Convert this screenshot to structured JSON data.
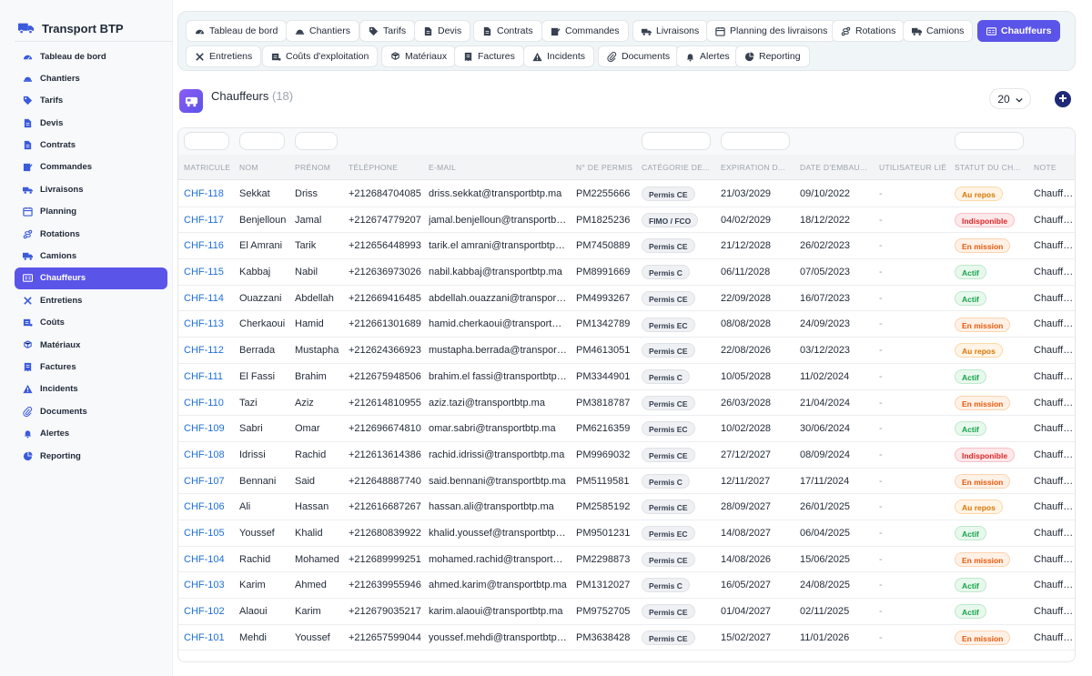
{
  "brand": {
    "name": "Transport BTP"
  },
  "sidebar": {
    "items": [
      {
        "label": "Tableau de bord",
        "icon": "dashboard-icon"
      },
      {
        "label": "Chantiers",
        "icon": "hardhat-icon"
      },
      {
        "label": "Tarifs",
        "icon": "tag-icon"
      },
      {
        "label": "Devis",
        "icon": "file-icon"
      },
      {
        "label": "Contrats",
        "icon": "file-icon"
      },
      {
        "label": "Commandes",
        "icon": "order-icon"
      },
      {
        "label": "Livraisons",
        "icon": "delivery-icon"
      },
      {
        "label": "Planning",
        "icon": "calendar-icon"
      },
      {
        "label": "Rotations",
        "icon": "route-icon"
      },
      {
        "label": "Camions",
        "icon": "truck-icon"
      },
      {
        "label": "Chauffeurs",
        "icon": "id-card-icon",
        "active": true
      },
      {
        "label": "Entretiens",
        "icon": "tools-icon"
      },
      {
        "label": "Coûts",
        "icon": "money-icon"
      },
      {
        "label": "Matériaux",
        "icon": "cubes-icon"
      },
      {
        "label": "Factures",
        "icon": "invoice-icon"
      },
      {
        "label": "Incidents",
        "icon": "warning-icon"
      },
      {
        "label": "Documents",
        "icon": "paperclip-icon"
      },
      {
        "label": "Alertes",
        "icon": "bell-icon"
      },
      {
        "label": "Reporting",
        "icon": "chart-pie-icon"
      }
    ]
  },
  "tabs": [
    {
      "label": "Tableau de bord",
      "icon": "dashboard-icon"
    },
    {
      "label": "Chantiers",
      "icon": "hardhat-icon"
    },
    {
      "label": "Tarifs",
      "icon": "tag-icon"
    },
    {
      "label": "Devis",
      "icon": "file-icon"
    },
    {
      "label": "Contrats",
      "icon": "file-icon"
    },
    {
      "label": "Commandes",
      "icon": "order-icon"
    },
    {
      "label": "Livraisons",
      "icon": "delivery-icon"
    },
    {
      "label": "Planning des livraisons",
      "icon": "calendar-icon"
    },
    {
      "label": "Rotations",
      "icon": "route-icon"
    },
    {
      "label": "Camions",
      "icon": "truck-icon"
    },
    {
      "label": "Chauffeurs",
      "icon": "id-card-icon",
      "active": true
    },
    {
      "label": "Entretiens",
      "icon": "tools-icon"
    },
    {
      "label": "Coûts d'exploitation",
      "icon": "money-icon"
    },
    {
      "label": "Matériaux",
      "icon": "cubes-icon"
    },
    {
      "label": "Factures",
      "icon": "invoice-icon"
    },
    {
      "label": "Incidents",
      "icon": "warning-icon"
    },
    {
      "label": "Documents",
      "icon": "paperclip-icon"
    },
    {
      "label": "Alertes",
      "icon": "bell-icon"
    },
    {
      "label": "Reporting",
      "icon": "chart-pie-icon"
    }
  ],
  "header": {
    "title": "Chauffeurs",
    "count": "(18)",
    "per_page": "20"
  },
  "colors": {
    "accent": "#5b54e8",
    "brand_icon": "#3b5bdb",
    "link": "#1d6fd8",
    "add_button": "#1e2a78"
  },
  "table": {
    "columns": [
      "MATRICULE",
      "NOM",
      "PRÉNOM",
      "TÉLÉPHONE",
      "E-MAIL",
      "N° DE PERMIS",
      "CATÉGORIE DE...",
      "EXPIRATION D...",
      "DATE D'EMBAU...",
      "UTILISATEUR LIÉ",
      "STATUT DU CH...",
      "NOTE"
    ],
    "rows": [
      {
        "matricule": "CHF-118",
        "nom": "Sekkat",
        "prenom": "Driss",
        "telephone": "+212684704085",
        "email": "driss.sekkat@transportbtp.ma",
        "permis": "PM2255666",
        "categorie": "Permis CE",
        "expiration": "21/03/2029",
        "embauche": "09/10/2022",
        "utilisateur": "-",
        "statut": "Au repos",
        "note": "Chauffeur"
      },
      {
        "matricule": "CHF-117",
        "nom": "Benjelloun",
        "prenom": "Jamal",
        "telephone": "+212674779207",
        "email": "jamal.benjelloun@transportbtp.ma",
        "permis": "PM1825236",
        "categorie": "FIMO / FCO",
        "expiration": "04/02/2029",
        "embauche": "18/12/2022",
        "utilisateur": "-",
        "statut": "Indisponible",
        "note": "Chauffeur"
      },
      {
        "matricule": "CHF-116",
        "nom": "El Amrani",
        "prenom": "Tarik",
        "telephone": "+212656448993",
        "email": "tarik.el amrani@transportbtp.ma",
        "permis": "PM7450889",
        "categorie": "Permis CE",
        "expiration": "21/12/2028",
        "embauche": "26/02/2023",
        "utilisateur": "-",
        "statut": "En mission",
        "note": "Chauffeur"
      },
      {
        "matricule": "CHF-115",
        "nom": "Kabbaj",
        "prenom": "Nabil",
        "telephone": "+212636973026",
        "email": "nabil.kabbaj@transportbtp.ma",
        "permis": "PM8991669",
        "categorie": "Permis C",
        "expiration": "06/11/2028",
        "embauche": "07/05/2023",
        "utilisateur": "-",
        "statut": "Actif",
        "note": "Chauffeur"
      },
      {
        "matricule": "CHF-114",
        "nom": "Ouazzani",
        "prenom": "Abdellah",
        "telephone": "+212669416485",
        "email": "abdellah.ouazzani@transportbtp.ma",
        "permis": "PM4993267",
        "categorie": "Permis CE",
        "expiration": "22/09/2028",
        "embauche": "16/07/2023",
        "utilisateur": "-",
        "statut": "Actif",
        "note": "Chauffeur"
      },
      {
        "matricule": "CHF-113",
        "nom": "Cherkaoui",
        "prenom": "Hamid",
        "telephone": "+212661301689",
        "email": "hamid.cherkaoui@transportbtp.ma",
        "permis": "PM1342789",
        "categorie": "Permis EC",
        "expiration": "08/08/2028",
        "embauche": "24/09/2023",
        "utilisateur": "-",
        "statut": "En mission",
        "note": "Chauffeur"
      },
      {
        "matricule": "CHF-112",
        "nom": "Berrada",
        "prenom": "Mustapha",
        "telephone": "+212624366923",
        "email": "mustapha.berrada@transportbtp.ma",
        "permis": "PM4613051",
        "categorie": "Permis CE",
        "expiration": "22/08/2026",
        "embauche": "03/12/2023",
        "utilisateur": "-",
        "statut": "Au repos",
        "note": "Chauffeur"
      },
      {
        "matricule": "CHF-111",
        "nom": "El Fassi",
        "prenom": "Brahim",
        "telephone": "+212675948506",
        "email": "brahim.el fassi@transportbtp.ma",
        "permis": "PM3344901",
        "categorie": "Permis C",
        "expiration": "10/05/2028",
        "embauche": "11/02/2024",
        "utilisateur": "-",
        "statut": "Actif",
        "note": "Chauffeur"
      },
      {
        "matricule": "CHF-110",
        "nom": "Tazi",
        "prenom": "Aziz",
        "telephone": "+212614810955",
        "email": "aziz.tazi@transportbtp.ma",
        "permis": "PM3818787",
        "categorie": "Permis CE",
        "expiration": "26/03/2028",
        "embauche": "21/04/2024",
        "utilisateur": "-",
        "statut": "En mission",
        "note": "Chauffeur"
      },
      {
        "matricule": "CHF-109",
        "nom": "Sabri",
        "prenom": "Omar",
        "telephone": "+212696674810",
        "email": "omar.sabri@transportbtp.ma",
        "permis": "PM6216359",
        "categorie": "Permis EC",
        "expiration": "10/02/2028",
        "embauche": "30/06/2024",
        "utilisateur": "-",
        "statut": "Actif",
        "note": "Chauffeur"
      },
      {
        "matricule": "CHF-108",
        "nom": "Idrissi",
        "prenom": "Rachid",
        "telephone": "+212613614386",
        "email": "rachid.idrissi@transportbtp.ma",
        "permis": "PM9969032",
        "categorie": "Permis CE",
        "expiration": "27/12/2027",
        "embauche": "08/09/2024",
        "utilisateur": "-",
        "statut": "Indisponible",
        "note": "Chauffeur"
      },
      {
        "matricule": "CHF-107",
        "nom": "Bennani",
        "prenom": "Said",
        "telephone": "+212648887740",
        "email": "said.bennani@transportbtp.ma",
        "permis": "PM5119581",
        "categorie": "Permis C",
        "expiration": "12/11/2027",
        "embauche": "17/11/2024",
        "utilisateur": "-",
        "statut": "En mission",
        "note": "Chauffeur"
      },
      {
        "matricule": "CHF-106",
        "nom": "Ali",
        "prenom": "Hassan",
        "telephone": "+212616687267",
        "email": "hassan.ali@transportbtp.ma",
        "permis": "PM2585192",
        "categorie": "Permis CE",
        "expiration": "28/09/2027",
        "embauche": "26/01/2025",
        "utilisateur": "-",
        "statut": "Au repos",
        "note": "Chauffeur"
      },
      {
        "matricule": "CHF-105",
        "nom": "Youssef",
        "prenom": "Khalid",
        "telephone": "+212680839922",
        "email": "khalid.youssef@transportbtp.ma",
        "permis": "PM9501231",
        "categorie": "Permis EC",
        "expiration": "14/08/2027",
        "embauche": "06/04/2025",
        "utilisateur": "-",
        "statut": "Actif",
        "note": "Chauffeur"
      },
      {
        "matricule": "CHF-104",
        "nom": "Rachid",
        "prenom": "Mohamed",
        "telephone": "+212689999251",
        "email": "mohamed.rachid@transportbtp.ma",
        "permis": "PM2298873",
        "categorie": "Permis CE",
        "expiration": "14/08/2026",
        "embauche": "15/06/2025",
        "utilisateur": "-",
        "statut": "En mission",
        "note": "Chauffeur"
      },
      {
        "matricule": "CHF-103",
        "nom": "Karim",
        "prenom": "Ahmed",
        "telephone": "+212639955946",
        "email": "ahmed.karim@transportbtp.ma",
        "permis": "PM1312027",
        "categorie": "Permis C",
        "expiration": "16/05/2027",
        "embauche": "24/08/2025",
        "utilisateur": "-",
        "statut": "Actif",
        "note": "Chauffeur"
      },
      {
        "matricule": "CHF-102",
        "nom": "Alaoui",
        "prenom": "Karim",
        "telephone": "+212679035217",
        "email": "karim.alaoui@transportbtp.ma",
        "permis": "PM9752705",
        "categorie": "Permis CE",
        "expiration": "01/04/2027",
        "embauche": "02/11/2025",
        "utilisateur": "-",
        "statut": "Actif",
        "note": "Chauffeur"
      },
      {
        "matricule": "CHF-101",
        "nom": "Mehdi",
        "prenom": "Youssef",
        "telephone": "+212657599044",
        "email": "youssef.mehdi@transportbtp.ma",
        "permis": "PM3638428",
        "categorie": "Permis CE",
        "expiration": "15/02/2027",
        "embauche": "11/01/2026",
        "utilisateur": "-",
        "statut": "En mission",
        "note": "Chauffeur"
      }
    ]
  }
}
